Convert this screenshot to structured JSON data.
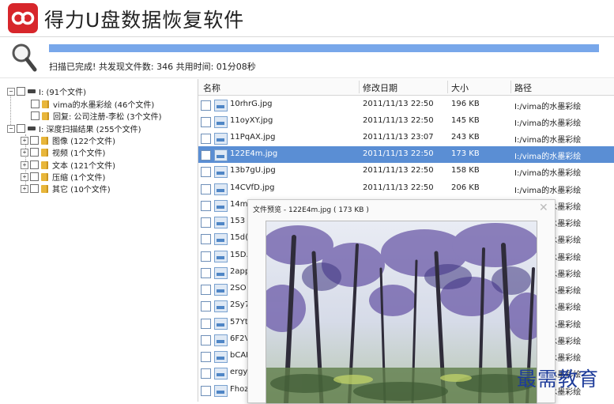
{
  "app": {
    "title": "得力U盘数据恢复软件"
  },
  "scan": {
    "status": "扫描已完成! 共发现文件数: 346  共用时间: 01分08秒",
    "progress_percent": 100
  },
  "tree": {
    "nodes": [
      {
        "label": "I: (91个文件)"
      },
      {
        "label": "vima的水墨彩绘 (46个文件)"
      },
      {
        "label": "回复: 公司注册-李松 (3个文件)"
      },
      {
        "label": "I: 深度扫描结果 (255个文件)"
      },
      {
        "label": "图像 (122个文件)"
      },
      {
        "label": "视频 (1个文件)"
      },
      {
        "label": "文本 (121个文件)"
      },
      {
        "label": "压缩 (1个文件)"
      },
      {
        "label": "其它 (10个文件)"
      }
    ]
  },
  "columns": {
    "name": "名称",
    "date": "修改日期",
    "size": "大小",
    "path": "路径"
  },
  "files": [
    {
      "name": "10rhrG.jpg",
      "date": "2011/11/13 22:50",
      "size": "196 KB",
      "path": "I:/vima的水墨彩绘"
    },
    {
      "name": "11oyXY.jpg",
      "date": "2011/11/13 22:50",
      "size": "145 KB",
      "path": "I:/vima的水墨彩绘"
    },
    {
      "name": "11PqAX.jpg",
      "date": "2011/11/13 23:07",
      "size": "243 KB",
      "path": "I:/vima的水墨彩绘"
    },
    {
      "name": "122E4m.jpg",
      "date": "2011/11/13 22:50",
      "size": "173 KB",
      "path": "I:/vima的水墨彩绘"
    },
    {
      "name": "13b7gU.jpg",
      "date": "2011/11/13 22:50",
      "size": "158 KB",
      "path": "I:/vima的水墨彩绘"
    },
    {
      "name": "14CVfD.jpg",
      "date": "2011/11/13 22:50",
      "size": "206 KB",
      "path": "I:/vima的水墨彩绘"
    },
    {
      "name": "14m",
      "date": "",
      "size": "",
      "path": "I:/vima的水墨彩绘"
    },
    {
      "name": "153",
      "date": "",
      "size": "",
      "path": "I:/vima的水墨彩绘"
    },
    {
      "name": "15d(",
      "date": "",
      "size": "",
      "path": "I:/vima的水墨彩绘"
    },
    {
      "name": "15D.",
      "date": "",
      "size": "",
      "path": "I:/vima的水墨彩绘"
    },
    {
      "name": "2app",
      "date": "",
      "size": "",
      "path": "I:/vima的水墨彩绘"
    },
    {
      "name": "2SO",
      "date": "",
      "size": "",
      "path": "I:/vima的水墨彩绘"
    },
    {
      "name": "2Sy7",
      "date": "",
      "size": "",
      "path": "I:/vima的水墨彩绘"
    },
    {
      "name": "57Yt",
      "date": "",
      "size": "",
      "path": "I:/vima的水墨彩绘"
    },
    {
      "name": "6F2V",
      "date": "",
      "size": "",
      "path": "I:/vima的水墨彩绘"
    },
    {
      "name": "bCAI",
      "date": "",
      "size": "",
      "path": "I:/vima的水墨彩绘"
    },
    {
      "name": "ergy",
      "date": "",
      "size": "",
      "path": "I:/vima的水墨彩绘"
    },
    {
      "name": "Fhoz",
      "date": "",
      "size": "",
      "path": "I:/vima的水墨彩绘"
    }
  ],
  "preview": {
    "title": "文件预览 - 122E4m.jpg ( 173 KB )",
    "close_symbol": "✕"
  },
  "watermark": "最需教育",
  "colors": {
    "accent": "#5a8ed4",
    "logo": "#d7262b",
    "progress": "#78a7ea"
  }
}
